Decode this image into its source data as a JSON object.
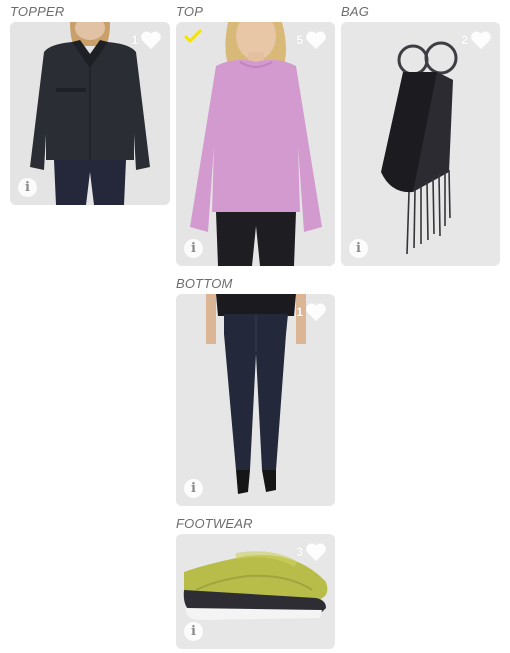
{
  "sections": {
    "topper": {
      "label": "TOPPER",
      "likes": "1"
    },
    "top": {
      "label": "TOP",
      "likes": "5",
      "selected": true
    },
    "bag": {
      "label": "BAG",
      "likes": "2"
    },
    "bottom": {
      "label": "BOTTOM",
      "likes": "1"
    },
    "footwear": {
      "label": "FOOTWEAR",
      "likes": "3"
    }
  },
  "icons": {
    "info": "i",
    "like": "heart-icon",
    "selected": "checkmark-icon"
  },
  "colors": {
    "card_bg": "#e6e6e6",
    "label": "#6d6d6d",
    "check": "#f5e400",
    "sweater": "#d39ad0",
    "jacket": "#2a2d33",
    "jeans": "#23283a",
    "sneaker": "#b8bd4a"
  }
}
